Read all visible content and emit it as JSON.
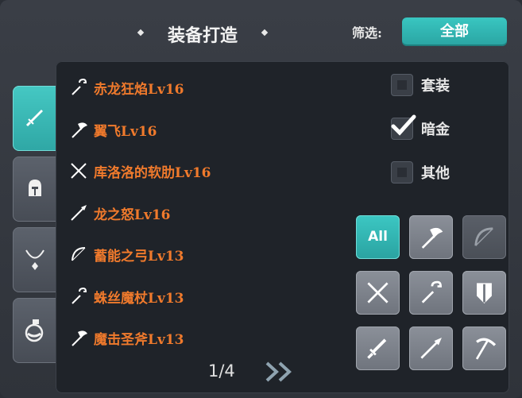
{
  "header": {
    "title": "装备打造",
    "filter_label": "筛选:",
    "filter_value": "全部"
  },
  "side_tabs": [
    {
      "icon": "sword-icon",
      "active": true
    },
    {
      "icon": "helmet-icon",
      "active": false
    },
    {
      "icon": "necklace-icon",
      "active": false
    },
    {
      "icon": "potion-icon",
      "active": false
    }
  ],
  "items": [
    {
      "name": "赤龙狂焰Lv16",
      "icon": "staff-icon"
    },
    {
      "name": "翼飞Lv16",
      "icon": "axe-icon"
    },
    {
      "name": "库洛洛的软肋Lv16",
      "icon": "dual-blades-icon"
    },
    {
      "name": "龙之怒Lv16",
      "icon": "spear-icon"
    },
    {
      "name": "蓄能之弓Lv13",
      "icon": "bow-icon"
    },
    {
      "name": "蛛丝魔杖Lv13",
      "icon": "staff-icon"
    },
    {
      "name": "魔击圣斧Lv13",
      "icon": "axe-icon"
    }
  ],
  "checkboxes": [
    {
      "label": "套装",
      "checked": false
    },
    {
      "label": "暗金",
      "checked": true
    },
    {
      "label": "其他",
      "checked": false
    }
  ],
  "type_buttons": [
    {
      "label": "All",
      "icon": "all",
      "state": "active"
    },
    {
      "icon": "axe-icon",
      "state": "normal"
    },
    {
      "icon": "bow-icon",
      "state": "dim"
    },
    {
      "icon": "dual-blades-icon",
      "state": "normal"
    },
    {
      "icon": "staff-icon",
      "state": "normal"
    },
    {
      "icon": "shield-icon",
      "state": "normal"
    },
    {
      "icon": "sword-icon",
      "state": "normal"
    },
    {
      "icon": "spear-icon",
      "state": "normal"
    },
    {
      "icon": "scythe-icon",
      "state": "normal"
    }
  ],
  "pagination": {
    "text": "1/4",
    "next_icon": "double-chevron-right-icon"
  },
  "colors": {
    "accent": "#35b9b5",
    "item_text": "#f07a2c"
  }
}
